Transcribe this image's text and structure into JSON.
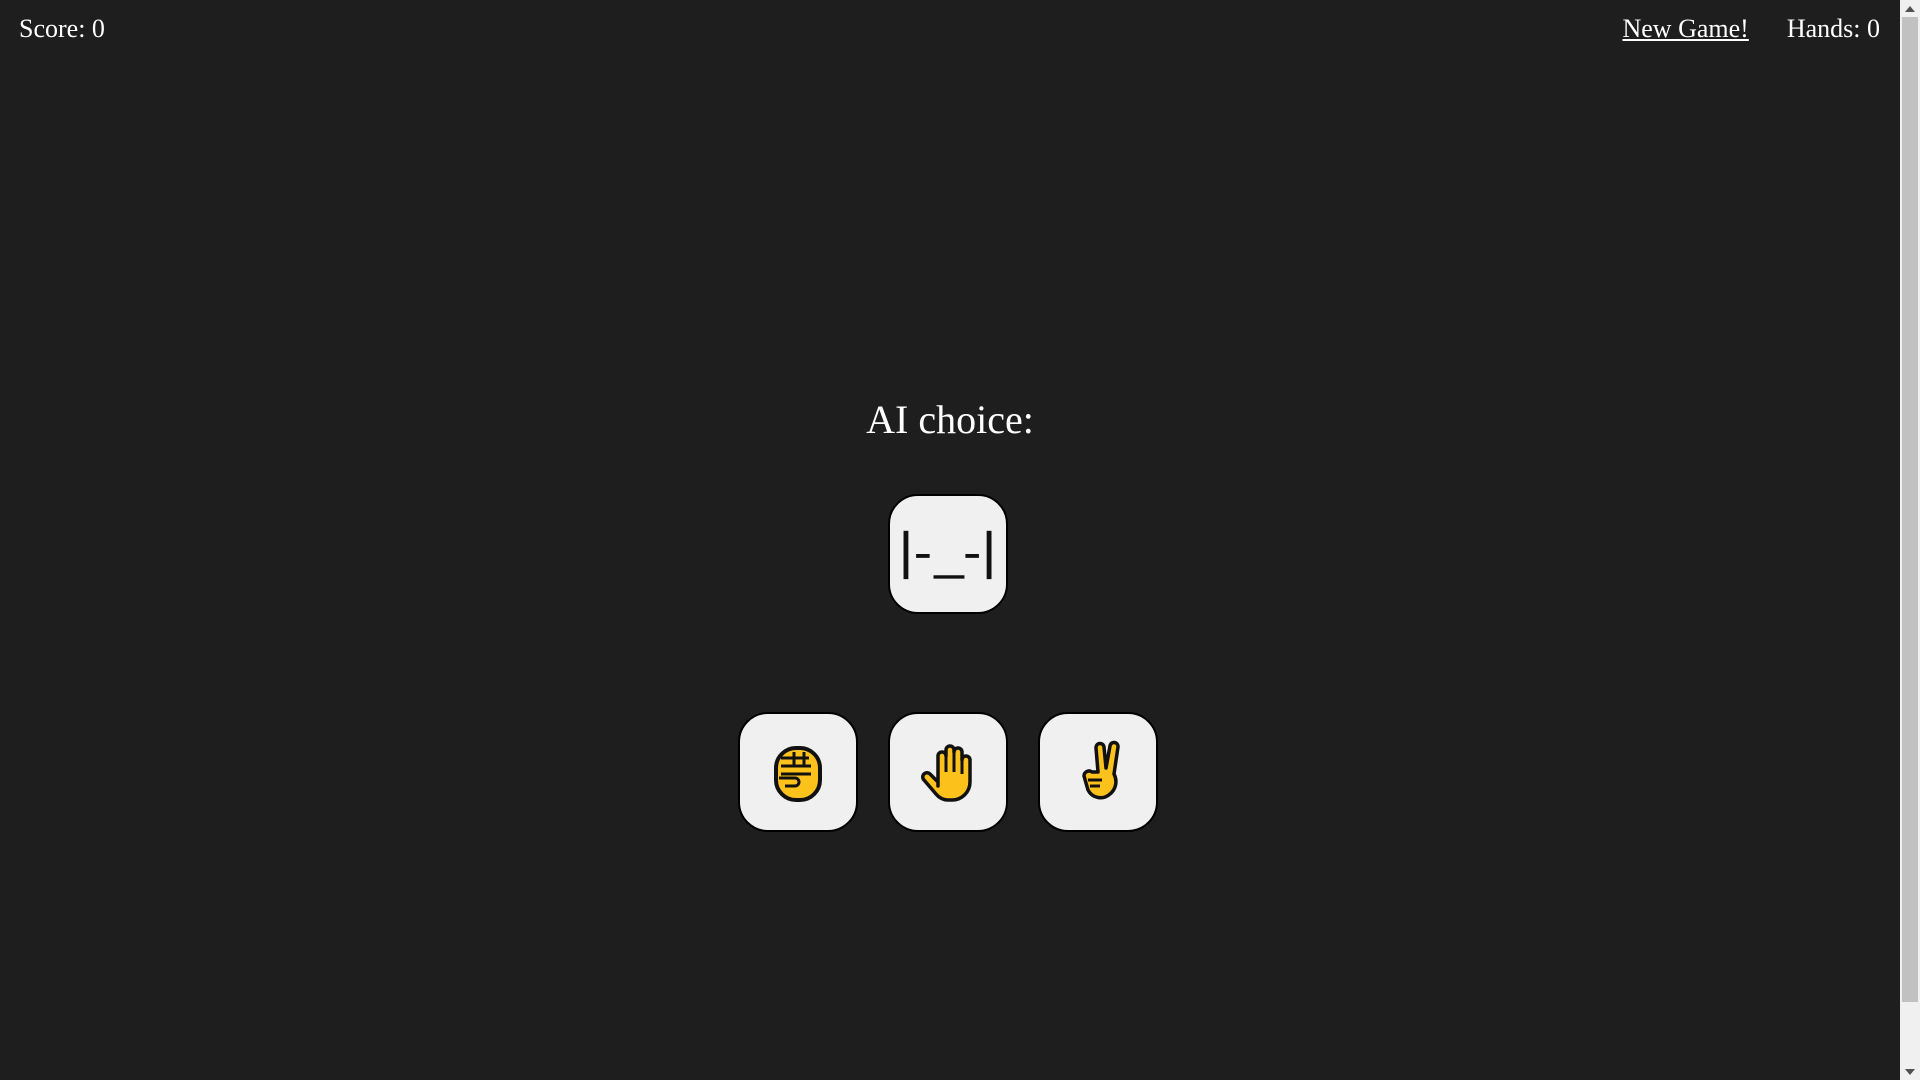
{
  "header": {
    "score_text": "Score: 0",
    "new_game_label": "New Game!",
    "hands_text": "Hands: 0"
  },
  "main": {
    "ai_choice_label": "AI choice:",
    "ai_face_icon": "thinking-face-icon",
    "choices": [
      {
        "name": "rock",
        "icon": "fist-icon"
      },
      {
        "name": "paper",
        "icon": "raised-hand-icon"
      },
      {
        "name": "scissors",
        "icon": "victory-hand-icon"
      }
    ]
  },
  "colors": {
    "background": "#1e1e1e",
    "tile": "#f0f0f0",
    "hand_yellow": "#fcc21b",
    "outline": "#111111"
  }
}
